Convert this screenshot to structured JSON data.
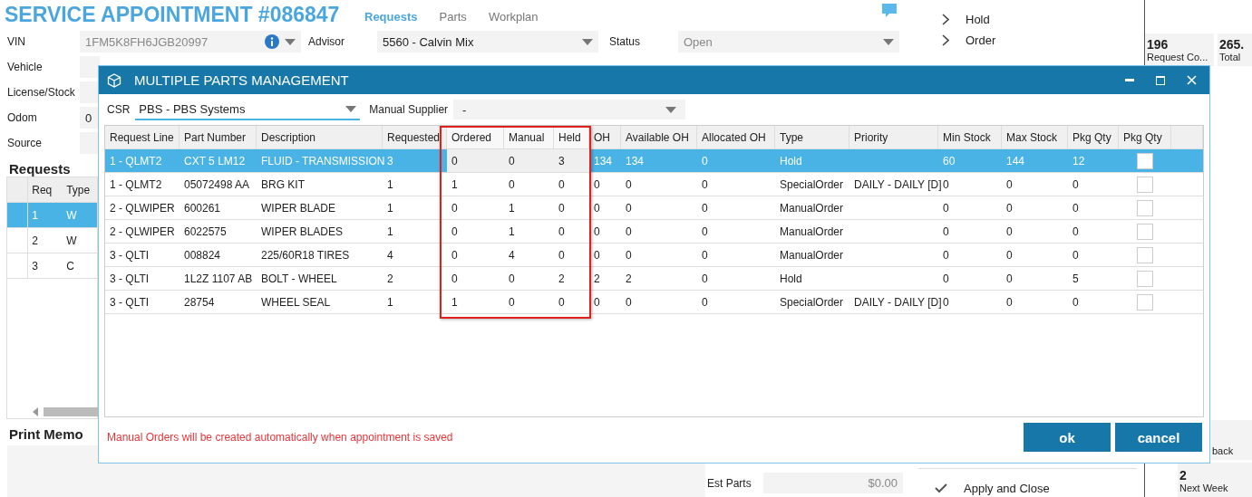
{
  "page": {
    "title": "SERVICE APPOINTMENT #086847",
    "tabs": [
      {
        "label": "Requests",
        "selected": true
      },
      {
        "label": "Parts",
        "selected": false
      },
      {
        "label": "Workplan",
        "selected": false
      }
    ]
  },
  "form": [
    {
      "label": "VIN",
      "value": "1FM5K8FH6JGB20997",
      "disabled": true
    },
    {
      "label": "Vehicle"
    },
    {
      "label": "License/Stock"
    },
    {
      "label": "Odom",
      "value": "0",
      "disabled": false
    },
    {
      "label": "Source"
    }
  ],
  "advisor": {
    "label": "Advisor",
    "value": "5560 - Calvin Mix",
    "disabled": false
  },
  "status": {
    "label": "Status",
    "value": "Open",
    "disabled": true
  },
  "requests": {
    "title": "Requests",
    "columns": [
      "Req",
      "Type"
    ],
    "rows": [
      {
        "cells": [
          "1",
          "W"
        ],
        "selected": true
      },
      {
        "cells": [
          "2",
          "W"
        ],
        "selected": false
      },
      {
        "cells": [
          "3",
          "C"
        ],
        "selected": false
      }
    ]
  },
  "memo": {
    "title": "Print Memo"
  },
  "estimate": {
    "label": "Est Parts",
    "value": "$0.00"
  },
  "tree": [
    {
      "label": "Hold"
    },
    {
      "label": "Order"
    }
  ],
  "apply": {
    "label": "Apply and Close"
  },
  "stats": [
    {
      "value": "196",
      "label": "Request Co..."
    },
    {
      "value": "265.",
      "label": "Total"
    }
  ],
  "bottom_cards": [
    {
      "label": "back"
    },
    {
      "value": "2",
      "label": "Next Week"
    }
  ],
  "dialog": {
    "title": "MULTIPLE PARTS MANAGEMENT",
    "csr": {
      "label": "CSR",
      "value": "PBS - PBS Systems"
    },
    "supplier": {
      "label": "Manual Supplier",
      "value": "-"
    },
    "columns": [
      {
        "label": "Request Line",
        "highlighted": false
      },
      {
        "label": "Part Number",
        "highlighted": false
      },
      {
        "label": "Description",
        "highlighted": false
      },
      {
        "label": "Requested",
        "highlighted": false
      },
      {
        "label": "Ordered",
        "highlighted": true
      },
      {
        "label": "Manual",
        "highlighted": true
      },
      {
        "label": "Held",
        "highlighted": true
      },
      {
        "label": "OH",
        "highlighted": false
      },
      {
        "label": "Available OH",
        "highlighted": false
      },
      {
        "label": "Allocated OH",
        "highlighted": false
      },
      {
        "label": "Type",
        "highlighted": false
      },
      {
        "label": "Priority",
        "highlighted": false
      },
      {
        "label": "Min Stock",
        "highlighted": false
      },
      {
        "label": "Max Stock",
        "highlighted": false
      },
      {
        "label": "Pkg Qty",
        "highlighted": false
      },
      {
        "label": "Pkg Qty",
        "highlighted": false
      }
    ],
    "rows": [
      {
        "selected": true,
        "checked": false,
        "cells": [
          "1 - QLMT2",
          "CXT 5 LM12",
          "FLUID - TRANSMISSION",
          "3",
          "0",
          "0",
          "3",
          "134",
          "134",
          "0",
          "Hold",
          "",
          "60",
          "144",
          "12"
        ]
      },
      {
        "selected": false,
        "checked": false,
        "cells": [
          "1 - QLMT2",
          "05072498 AA",
          "BRG KIT",
          "1",
          "1",
          "0",
          "0",
          "0",
          "0",
          "0",
          "SpecialOrder",
          "DAILY - DAILY [D]",
          "0",
          "0",
          "0"
        ]
      },
      {
        "selected": false,
        "checked": false,
        "cells": [
          "2 - QLWIPER",
          "600261",
          "WIPER BLADE",
          "1",
          "0",
          "1",
          "0",
          "0",
          "0",
          "0",
          "ManualOrder",
          "",
          "0",
          "0",
          "0"
        ]
      },
      {
        "selected": false,
        "checked": false,
        "cells": [
          "2 - QLWIPER",
          "6022575",
          "WIPER BLADES",
          "1",
          "0",
          "1",
          "0",
          "0",
          "0",
          "0",
          "ManualOrder",
          "",
          "0",
          "0",
          "0"
        ]
      },
      {
        "selected": false,
        "checked": false,
        "cells": [
          "3 - QLTI",
          "008824",
          "225/60R18 TIRES",
          "4",
          "0",
          "4",
          "0",
          "0",
          "0",
          "0",
          "ManualOrder",
          "",
          "0",
          "0",
          "0"
        ]
      },
      {
        "selected": false,
        "checked": false,
        "cells": [
          "3 - QLTI",
          "1L2Z 1107 AB",
          "BOLT - WHEEL",
          "2",
          "0",
          "0",
          "2",
          "2",
          "2",
          "0",
          "Hold",
          "",
          "0",
          "0",
          "5"
        ]
      },
      {
        "selected": false,
        "checked": false,
        "cells": [
          "3 - QLTI",
          "28754",
          "WHEEL SEAL",
          "1",
          "1",
          "0",
          "0",
          "0",
          "0",
          "0",
          "SpecialOrder",
          "DAILY - DAILY [D]",
          "0",
          "0",
          "0"
        ]
      }
    ],
    "message": "Manual Orders will be created automatically when appointment is saved",
    "buttons": [
      "ok",
      "cancel"
    ]
  }
}
